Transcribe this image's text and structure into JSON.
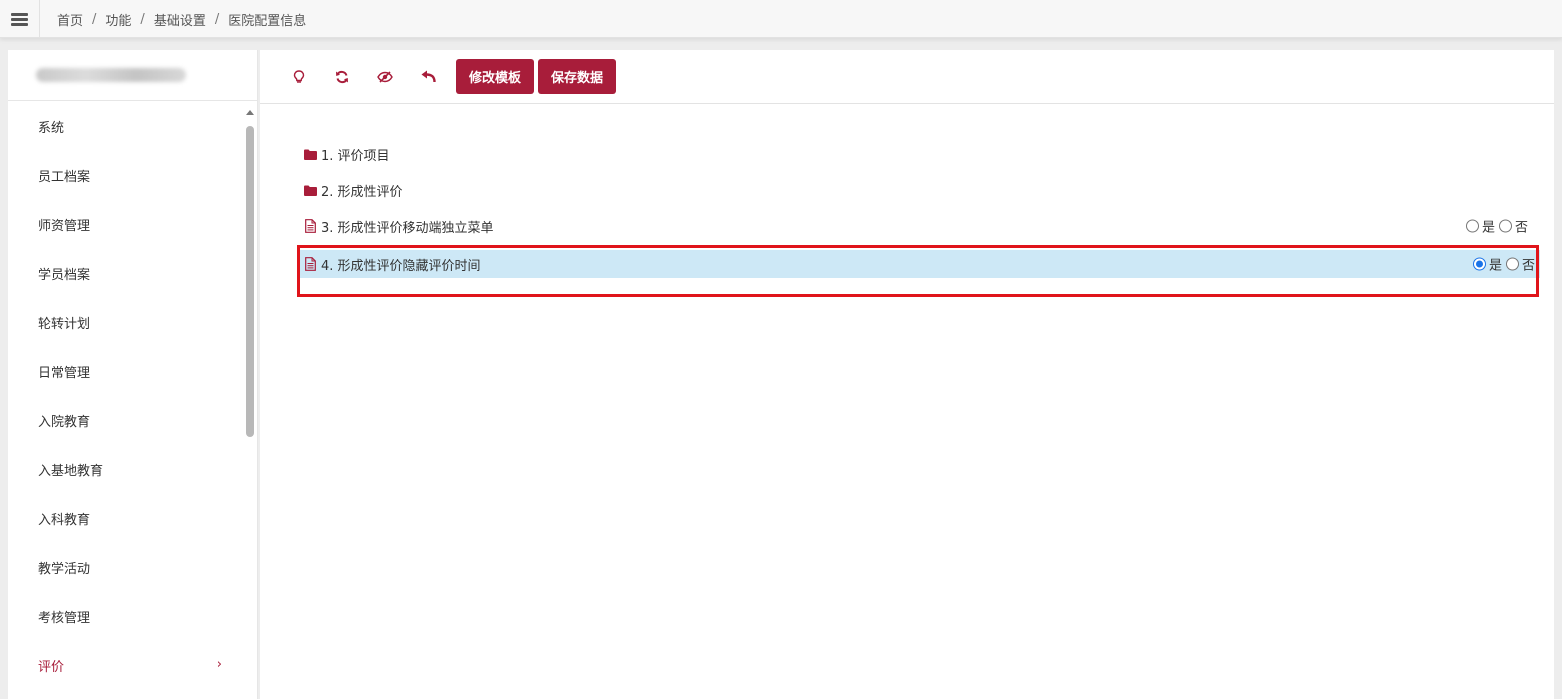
{
  "breadcrumb": [
    "首页",
    "功能",
    "基础设置",
    "医院配置信息"
  ],
  "breadcrumb_separator": "/",
  "sidebar": {
    "items": [
      {
        "label": "系统"
      },
      {
        "label": "员工档案"
      },
      {
        "label": "师资管理"
      },
      {
        "label": "学员档案"
      },
      {
        "label": "轮转计划"
      },
      {
        "label": "日常管理"
      },
      {
        "label": "入院教育"
      },
      {
        "label": "入基地教育"
      },
      {
        "label": "入科教育"
      },
      {
        "label": "教学活动"
      },
      {
        "label": "考核管理"
      },
      {
        "label": "评价",
        "active": true
      }
    ],
    "active_chevron": "›"
  },
  "toolbar": {
    "icons": [
      "lightbulb-icon",
      "refresh-icon",
      "eye-slash-icon",
      "undo-icon"
    ],
    "edit_template_label": "修改模板",
    "save_data_label": "保存数据"
  },
  "tree": {
    "items": [
      {
        "label": "1. 评价项目",
        "type": "folder"
      },
      {
        "label": "2. 形成性评价",
        "type": "folder"
      },
      {
        "label": "3. 形成性评价移动端独立菜单",
        "type": "file",
        "yes_label": "是",
        "no_label": "否",
        "selected_value": null
      },
      {
        "label": "4. 形成性评价隐藏评价时间",
        "type": "file",
        "yes_label": "是",
        "no_label": "否",
        "selected_value": "是",
        "highlighted": true
      }
    ]
  },
  "colors": {
    "accent": "#a81d3a",
    "selected_row": "#cde8f6",
    "highlight_border": "#e0141a"
  }
}
